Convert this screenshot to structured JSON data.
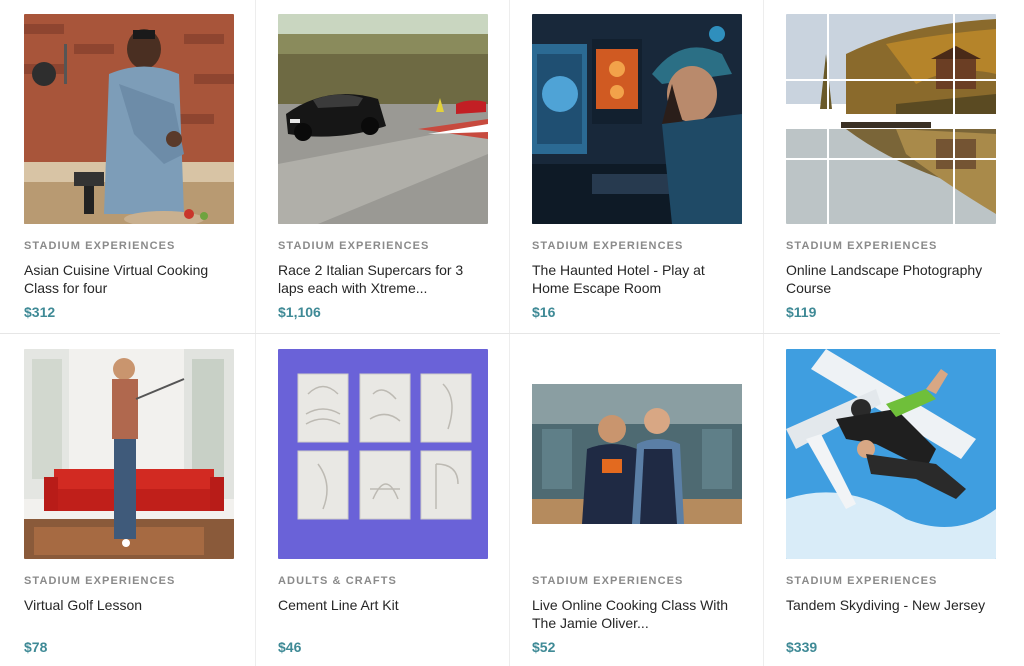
{
  "cards": [
    {
      "category": "STADIUM EXPERIENCES",
      "title": "Asian Cuisine Virtual Cooking Class for four",
      "price": "$312",
      "image": "chef-cooking-photo"
    },
    {
      "category": "STADIUM EXPERIENCES",
      "title": "Race 2 Italian Supercars for 3 laps each with Xtreme...",
      "price": "$1,106",
      "image": "supercar-track-photo"
    },
    {
      "category": "STADIUM EXPERIENCES",
      "title": "The Haunted Hotel - Play at Home Escape Room",
      "price": "$16",
      "image": "gamer-computer-photo"
    },
    {
      "category": "STADIUM EXPERIENCES",
      "title": "Online Landscape Photography Course",
      "price": "$119",
      "image": "lake-landscape-photo"
    },
    {
      "category": "STADIUM EXPERIENCES",
      "title": "Virtual Golf Lesson",
      "price": "$78",
      "image": "golf-living-room-photo"
    },
    {
      "category": "ADULTS & CRAFTS",
      "title": "Cement Line Art Kit",
      "price": "$46",
      "image": "cement-tiles-photo"
    },
    {
      "category": "STADIUM EXPERIENCES",
      "title": "Live Online Cooking Class With The Jamie Oliver...",
      "price": "$52",
      "image": "chefs-kitchen-photo"
    },
    {
      "category": "STADIUM EXPERIENCES",
      "title": "Tandem Skydiving - New Jersey",
      "price": "$339",
      "image": "skydiving-photo"
    }
  ],
  "colors": {
    "price": "#3f8a96",
    "category": "#8a8a8a"
  }
}
